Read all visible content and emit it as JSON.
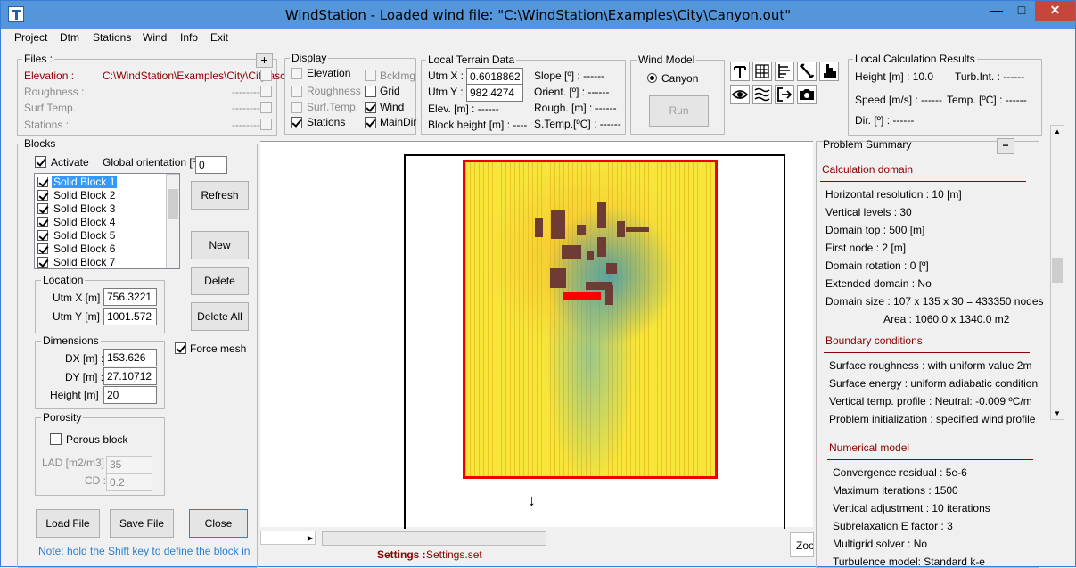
{
  "title": "WindStation - Loaded wind file:  \"C:\\WindStation\\Examples\\City\\Canyon.out\"",
  "window_buttons": {
    "min": "—",
    "max": "□",
    "close": "✕"
  },
  "menu": [
    "Project",
    "Dtm",
    "Stations",
    "Wind",
    "Info",
    "Exit"
  ],
  "files": {
    "title": "Files :",
    "add": "+",
    "rows": [
      {
        "label": "Elevation :",
        "value": "C:\\WindStation\\Examples\\City\\City.asc"
      },
      {
        "label": "Roughness :",
        "value": "---------"
      },
      {
        "label": "Surf.Temp.",
        "value": "---------"
      },
      {
        "label": "Stations :",
        "value": "---------"
      }
    ]
  },
  "display": {
    "title": "Display",
    "items": [
      "Elevation",
      "BckImg",
      "Roughness",
      "Grid",
      "Surf.Temp.",
      "Wind",
      "Stations",
      "MainDir"
    ]
  },
  "terrain": {
    "title": "Local Terrain Data",
    "utmx_label": "Utm X :",
    "utmx": "0.6018862",
    "utmy_label": "Utm Y :",
    "utmy": "982.4274",
    "elev": "Elev. [m] : ------",
    "block_height": "Block height [m] : ----",
    "slope": "Slope [º] : ------",
    "orient": "Orient. [º] : ------",
    "rough": "Rough. [m] : ------",
    "stemp": "S.Temp.[ºC] : ------"
  },
  "wind_model": {
    "title": "Wind Model",
    "option": "Canyon",
    "run": "Run"
  },
  "local_results": {
    "title": "Local Calculation Results",
    "height": "Height [m] : 10.0",
    "turb": "Turb.Int. : ------",
    "speed": "Speed [m/s] : ------",
    "temp": "Temp. [ºC] : ------",
    "dir": "Dir. [º] : ------"
  },
  "blocks": {
    "title": "Blocks",
    "activate": "Activate",
    "orientation_label": "Global orientation [º] :",
    "orientation": "0",
    "list": [
      "Solid Block 1",
      "Solid Block 2",
      "Solid Block 3",
      "Solid Block 4",
      "Solid Block 5",
      "Solid Block 6",
      "Solid Block 7"
    ],
    "refresh": "Refresh",
    "new": "New",
    "delete": "Delete",
    "delete_all": "Delete All",
    "location": {
      "title": "Location",
      "x_label": "Utm X [m] :",
      "x": "756.3221",
      "y_label": "Utm Y [m] :",
      "y": "1001.572"
    },
    "dimensions": {
      "title": "Dimensions",
      "dx_label": "DX [m] :",
      "dx": "153.626",
      "dy_label": "DY [m] :",
      "dy": "27.10712",
      "h_label": "Height [m] :",
      "h": "20"
    },
    "force_mesh": "Force mesh",
    "porosity": {
      "title": "Porosity",
      "porous": "Porous block",
      "lad_label": "LAD [m2/m3] :",
      "lad": "35",
      "cd_label": "CD :",
      "cd": "0.2"
    },
    "load_file": "Load File",
    "save_file": "Save File",
    "close": "Close",
    "note": "Note: hold the Shift key to define the block in"
  },
  "status": {
    "settings_label": "Settings :",
    "settings_value": "Settings.set",
    "zoom": "Zoo"
  },
  "summary": {
    "title": "Problem Summary",
    "collapse": "−",
    "calc_domain": "Calculation domain",
    "calc_lines": [
      "Horizontal resolution : 10 [m]",
      "Vertical levels : 30",
      "Domain top : 500 [m]",
      "First node : 2 [m]",
      "Domain rotation : 0 [º]",
      "Extended domain : No",
      "Domain size : 107 x 135 x 30 = 433350 nodes",
      "Area : 1060.0 x 1340.0 m2"
    ],
    "boundary": "Boundary conditions",
    "boundary_lines": [
      "Surface roughness : with uniform value 2m",
      "Surface energy : uniform adiabatic condition",
      "Vertical temp. profile : Neutral: -0.009 ºC/m",
      "Problem initialization : specified wind profile"
    ],
    "numerical": "Numerical model",
    "numerical_lines": [
      "Convergence residual : 5e-6",
      "Maximum iterations : 1500",
      "Vertical adjustment : 10 iterations",
      "Subrelaxation E factor : 3",
      "Multigrid solver : No",
      "Turbulence model: Standard k-e"
    ]
  },
  "colors": {
    "title_bar": "#5496d9",
    "close": "#c7463c",
    "domain_border": "#ff0000",
    "block": "#6e3b35",
    "selection": "#3399ff",
    "section_head": "#8b0000"
  }
}
